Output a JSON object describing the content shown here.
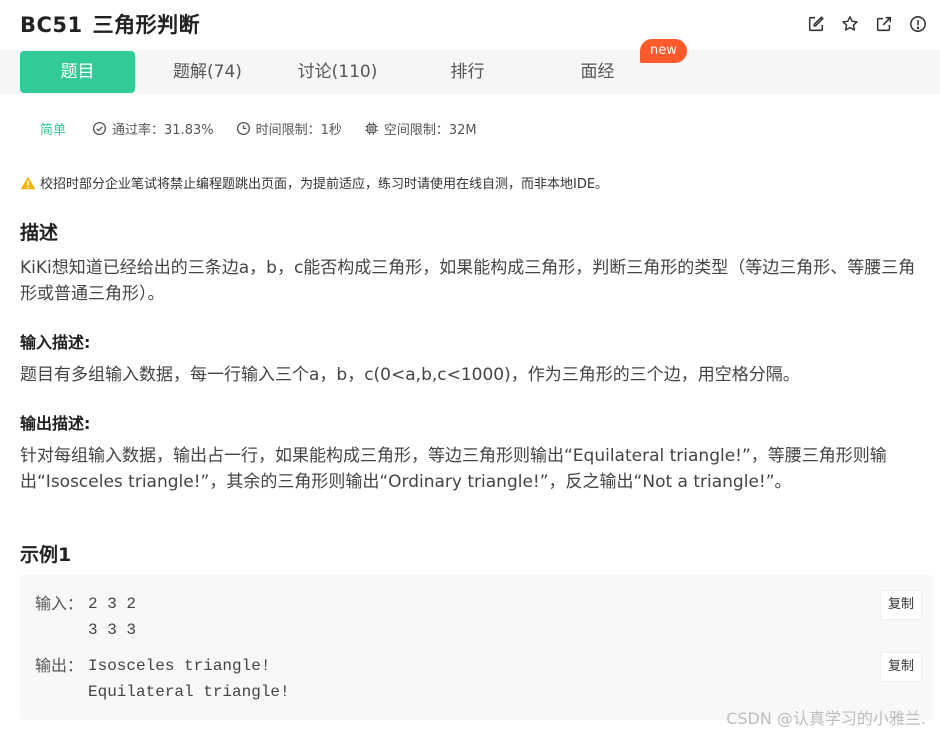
{
  "header": {
    "problem_id": "BC51",
    "problem_title": "三角形判断",
    "icons": [
      "edit-icon",
      "star-icon",
      "external-link-icon",
      "info-icon"
    ]
  },
  "tabs": [
    {
      "label": "题目",
      "active": true
    },
    {
      "label": "题解(74)",
      "active": false
    },
    {
      "label": "讨论(110)",
      "active": false
    },
    {
      "label": "排行",
      "active": false
    },
    {
      "label": "面经",
      "active": false
    }
  ],
  "new_badge": "new",
  "meta": {
    "difficulty": "简单",
    "pass_rate": "通过率：31.83%",
    "time_limit": "时间限制：1秒",
    "space_limit": "空间限制：32M"
  },
  "warning": "校招时部分企业笔试将禁止编程题跳出页面，为提前适应，练习时请使用在线自测，而非本地IDE。",
  "description": {
    "heading": "描述",
    "text": "KiKi想知道已经给出的三条边a，b，c能否构成三角形，如果能构成三角形，判断三角形的类型（等边三角形、等腰三角形或普通三角形）。"
  },
  "input_desc": {
    "heading": "输入描述:",
    "text": "题目有多组输入数据，每一行输入三个a，b，c(0<a,b,c<1000)，作为三角形的三个边，用空格分隔。"
  },
  "output_desc": {
    "heading": "输出描述:",
    "text": "针对每组输入数据，输出占一行，如果能构成三角形，等边三角形则输出“Equilateral triangle!”，等腰三角形则输出“Isosceles triangle!”，其余的三角形则输出“Ordinary triangle!”，反之输出“Not a triangle!”。"
  },
  "example": {
    "heading": "示例1",
    "input_label": "输入：",
    "input_value": "2 3 2\n3 3 3",
    "output_label": "输出：",
    "output_value": "Isosceles triangle!\nEquilateral triangle!",
    "copy_label": "复制"
  },
  "watermark": "CSDN @认真学习的小雅兰.",
  "colors": {
    "accent": "#32ca99",
    "new_badge": "#ff5a2b",
    "warning": "#f5b400"
  }
}
